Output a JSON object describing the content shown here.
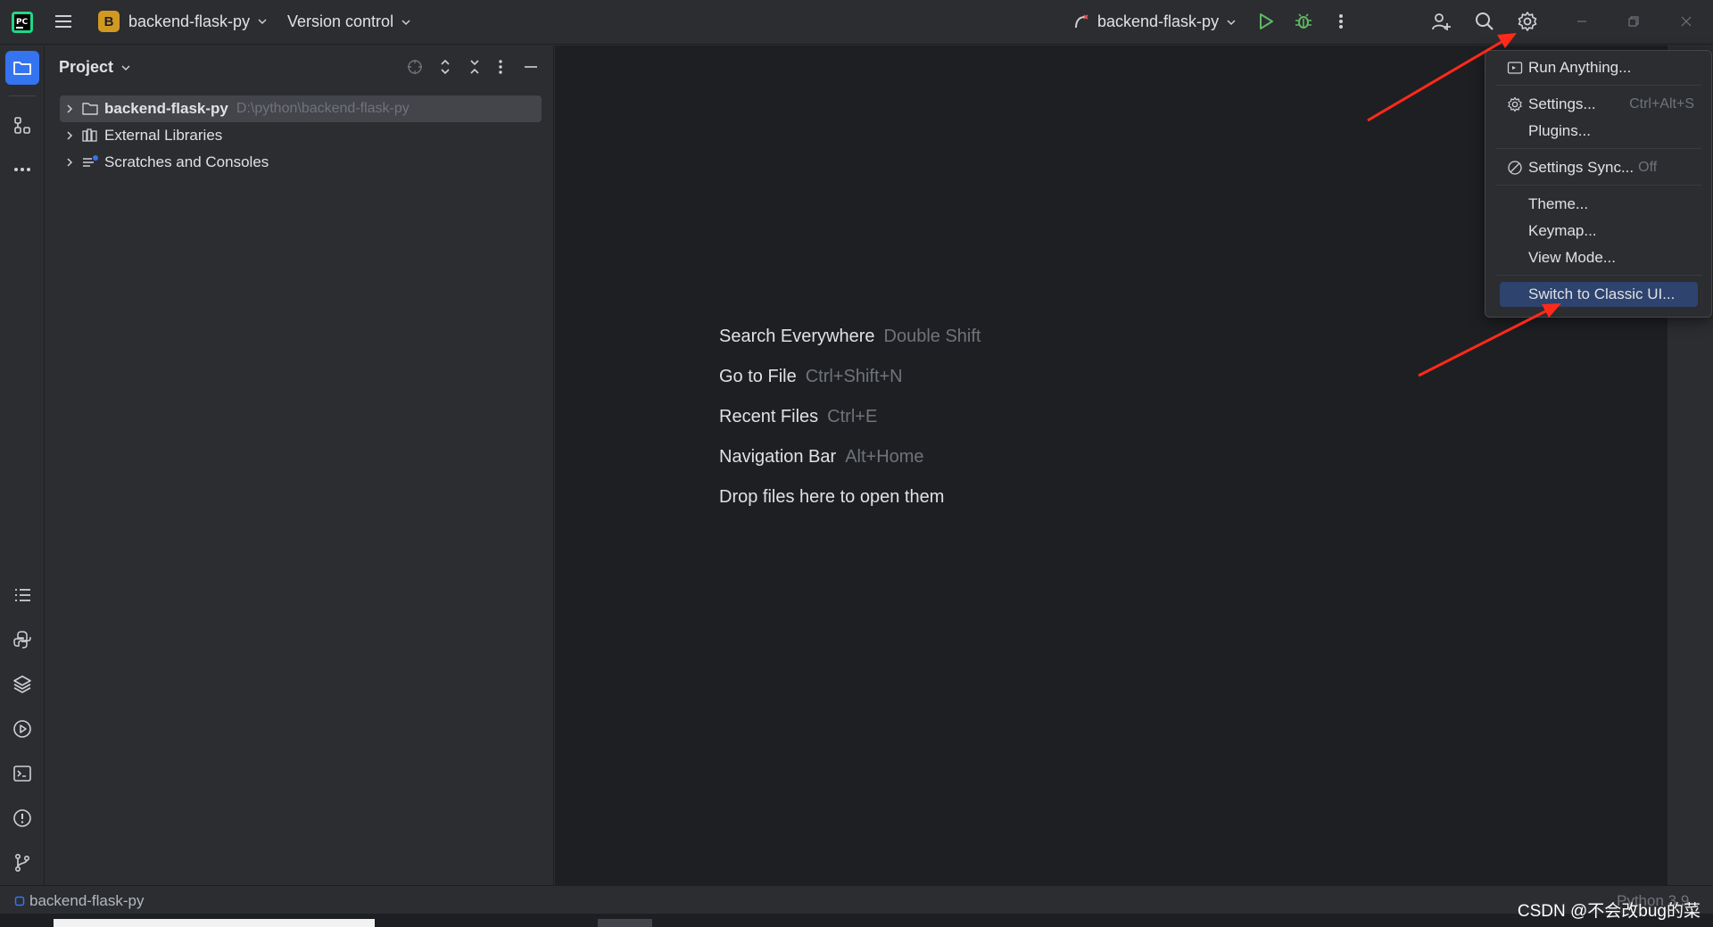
{
  "titlebar": {
    "project_badge": "B",
    "project_name": "backend-flask-py",
    "vcs_label": "Version control",
    "run_config": "backend-flask-py"
  },
  "project_panel": {
    "title": "Project",
    "tree": [
      {
        "label": "backend-flask-py",
        "path": "D:\\python\\backend-flask-py"
      },
      {
        "label": "External Libraries"
      },
      {
        "label": "Scratches and Consoles"
      }
    ]
  },
  "editor": {
    "hints": [
      {
        "label": "Search Everywhere",
        "shortcut": "Double Shift"
      },
      {
        "label": "Go to File",
        "shortcut": "Ctrl+Shift+N"
      },
      {
        "label": "Recent Files",
        "shortcut": "Ctrl+E"
      },
      {
        "label": "Navigation Bar",
        "shortcut": "Alt+Home"
      },
      {
        "label": "Drop files here to open them",
        "shortcut": ""
      }
    ]
  },
  "menu": {
    "items": [
      {
        "label": "Run Anything...",
        "shortcut": ""
      },
      {
        "label": "Settings...",
        "shortcut": "Ctrl+Alt+S"
      },
      {
        "label": "Plugins...",
        "shortcut": ""
      },
      {
        "label": "Settings Sync...",
        "shortcut": "Off"
      },
      {
        "label": "Theme...",
        "shortcut": ""
      },
      {
        "label": "Keymap...",
        "shortcut": ""
      },
      {
        "label": "View Mode...",
        "shortcut": ""
      },
      {
        "label": "Switch to Classic UI...",
        "shortcut": ""
      }
    ]
  },
  "statusbar": {
    "project": "backend-flask-py",
    "interpreter": "Python 3.9"
  },
  "watermark": "CSDN @不会改bug的菜",
  "colors": {
    "accent": "#3574f0",
    "annotation_arrow": "#ff2a1a",
    "menu_highlight": "#2e436e"
  }
}
